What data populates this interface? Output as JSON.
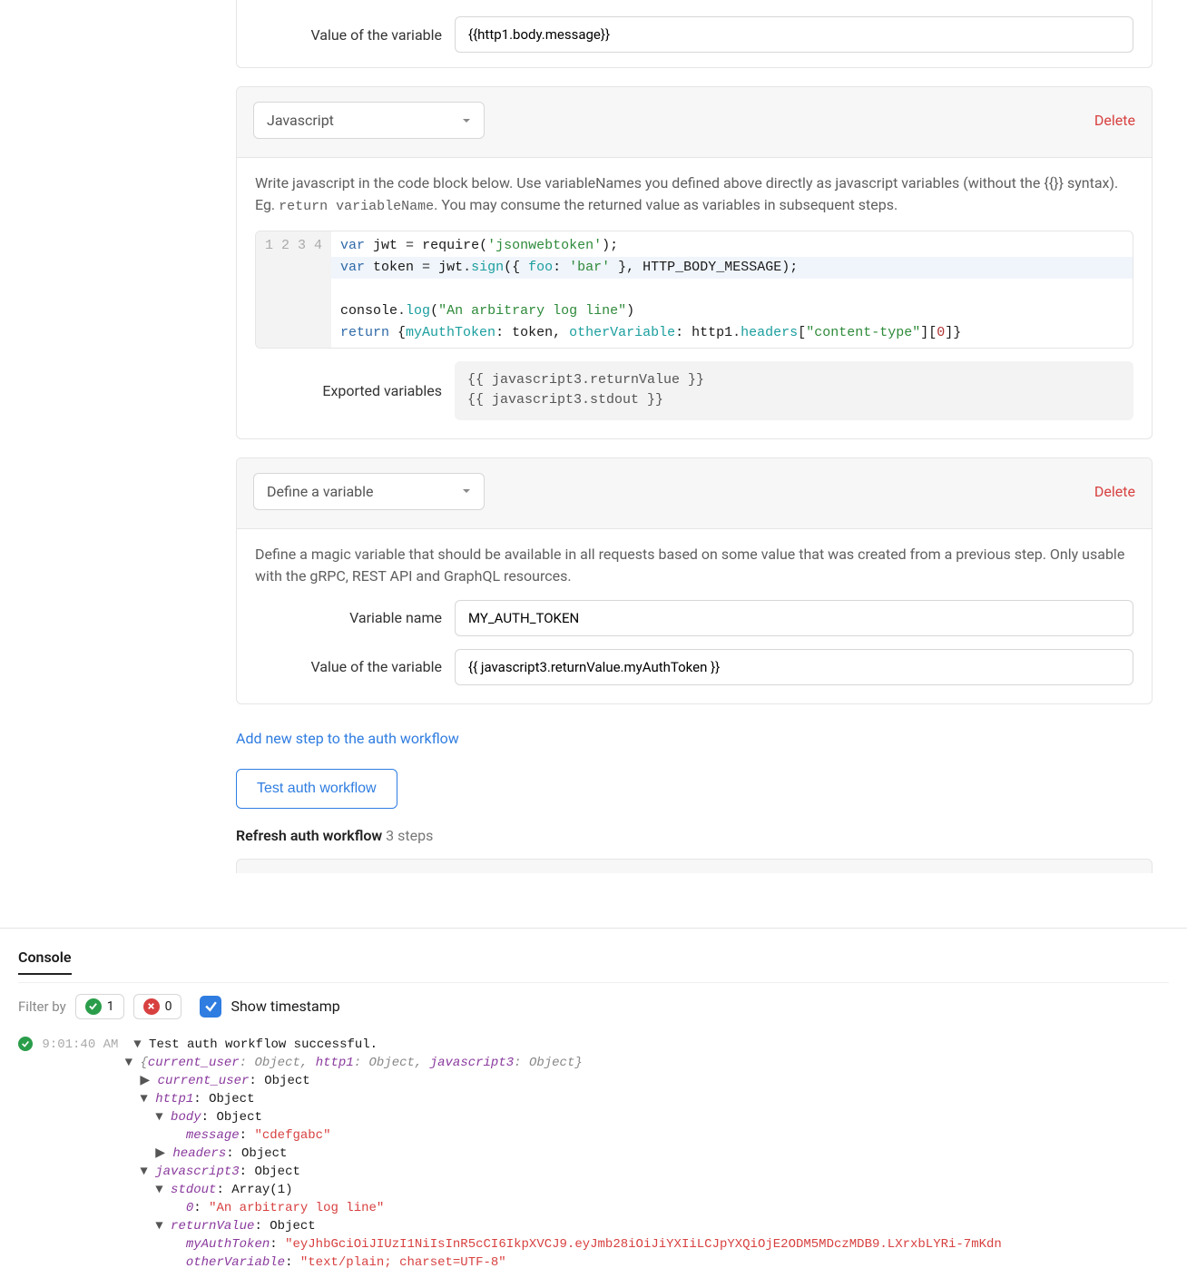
{
  "top_partial": {
    "label": "Value of the variable",
    "value": "{{http1.body.message}}"
  },
  "js_card": {
    "select_label": "Javascript",
    "delete": "Delete",
    "desc_pre": "Write javascript in the code block below. Use variableNames you defined above directly as javascript variables (without the {{}} syntax). Eg. ",
    "desc_code": "return variableName",
    "desc_post": ". You may consume the returned value as variables in subsequent steps.",
    "exported_label": "Exported variables",
    "exported_1": "{{ javascript3.returnValue }}",
    "exported_2": "{{ javascript3.stdout }}",
    "code": {
      "l1": {
        "a": "var",
        "b": " jwt ",
        "c": "=",
        "d": " require(",
        "e": "'jsonwebtoken'",
        "f": ");"
      },
      "l2": {
        "a": "var",
        "b": " token ",
        "c": "=",
        "d": " jwt",
        "e": ".",
        "f": "sign",
        "g": "({ ",
        "h": "foo",
        "i": ": ",
        "j": "'bar'",
        "k": " }, HTTP_BODY_MESSAGE);"
      },
      "l3": {
        "a": "console",
        "b": ".",
        "c": "log",
        "d": "(",
        "e": "\"An arbitrary log line\"",
        "f": ")"
      },
      "l4": {
        "a": "return",
        "b": " {",
        "c": "myAuthToken",
        "d": ": token, ",
        "e": "otherVariable",
        "f": ": http1",
        "g": ".",
        "h": "headers",
        "i": "[",
        "j": "\"content-type\"",
        "k": "][",
        "l": "0",
        "m": "]}"
      }
    }
  },
  "var_card": {
    "select_label": "Define a variable",
    "delete": "Delete",
    "desc": "Define a magic variable that should be available in all requests based on some value that was created from a previous step. Only usable with the gRPC, REST API and GraphQL resources.",
    "name_label": "Variable name",
    "name_value": "MY_AUTH_TOKEN",
    "value_label": "Value of the variable",
    "value_value": "{{ javascript3.returnValue.myAuthToken }}"
  },
  "add_step": "Add new step to the auth workflow",
  "test_btn": "Test auth workflow",
  "refresh": {
    "label": "Refresh auth workflow",
    "steps": "3 steps"
  },
  "console": {
    "tab": "Console",
    "filter_by": "Filter by",
    "ok_count": "1",
    "err_count": "0",
    "show_ts": "Show timestamp",
    "log": {
      "ts": "9:01:40 AM",
      "success": "Test auth workflow successful.",
      "k_current_user": "current_user",
      "k_http1": "http1",
      "k_javascript3": "javascript3",
      "t_object": "Object",
      "k_body": "body",
      "k_message": "message",
      "v_message": "\"cdefgabc\"",
      "k_headers": "headers",
      "k_stdout": "stdout",
      "t_array1": "Array(1)",
      "k_0": "0",
      "v_stdout0": "\"An arbitrary log line\"",
      "k_returnValue": "returnValue",
      "k_myAuthToken": "myAuthToken",
      "v_myAuthToken": "\"eyJhbGciOiJIUzI1NiIsInR5cCI6IkpXVCJ9.eyJmb28iOiJiYXIiLCJpYXQiOjE2ODM5MDczMDB9.LXrxbLYRi-7mKdn",
      "k_otherVariable": "otherVariable",
      "v_otherVariable": "\"text/plain; charset=UTF-8\""
    }
  }
}
